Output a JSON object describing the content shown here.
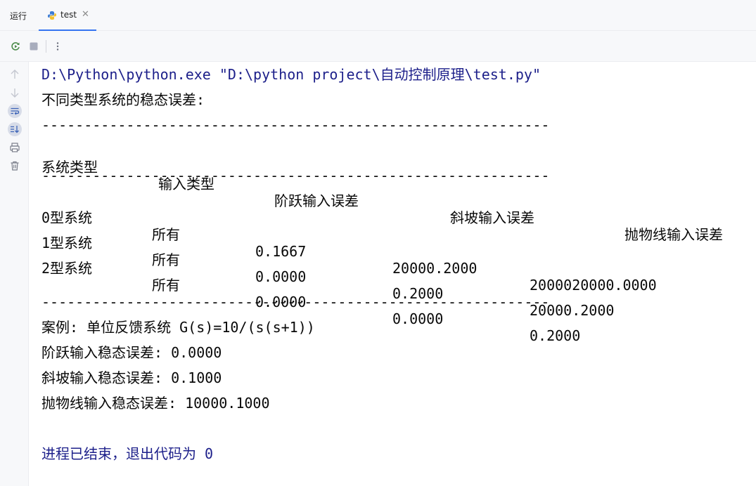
{
  "tabs": {
    "run_label": "运行",
    "active_tab": "test"
  },
  "toolbar": {
    "icons": [
      "rerun-icon",
      "stop-icon",
      "more-options-icon"
    ]
  },
  "gutter": {
    "icons": [
      "arrow-up-icon",
      "arrow-down-icon",
      "soft-wrap-icon",
      "scroll-to-end-icon",
      "print-icon",
      "trash-icon"
    ]
  },
  "console": {
    "command": "D:\\Python\\python.exe \"D:\\python project\\自动控制原理\\test.py\"",
    "heading": "不同类型系统的稳态误差:",
    "separator": "------------------------------------------------------------",
    "table": {
      "headers": [
        "系统类型",
        "输入类型",
        "阶跃输入误差",
        "斜坡输入误差",
        "抛物线输入误差"
      ],
      "rows": [
        [
          "0型系统",
          "所有",
          "0.1667",
          "20000.2000",
          "2000020000.0000"
        ],
        [
          "1型系统",
          "所有",
          "0.0000",
          "0.2000",
          "20000.2000"
        ],
        [
          "2型系统",
          "所有",
          "0.0000",
          "0.0000",
          "0.2000"
        ]
      ]
    },
    "case_title": "案例: 单位反馈系统 G(s)=10/(s(s+1))",
    "step_error": "阶跃输入稳态误差: 0.0000",
    "ramp_error": "斜坡输入稳态误差: 0.1000",
    "parabolic_error": "抛物线输入稳态误差: 10000.1000",
    "exit_message": "进程已结束，退出代码为 0"
  }
}
